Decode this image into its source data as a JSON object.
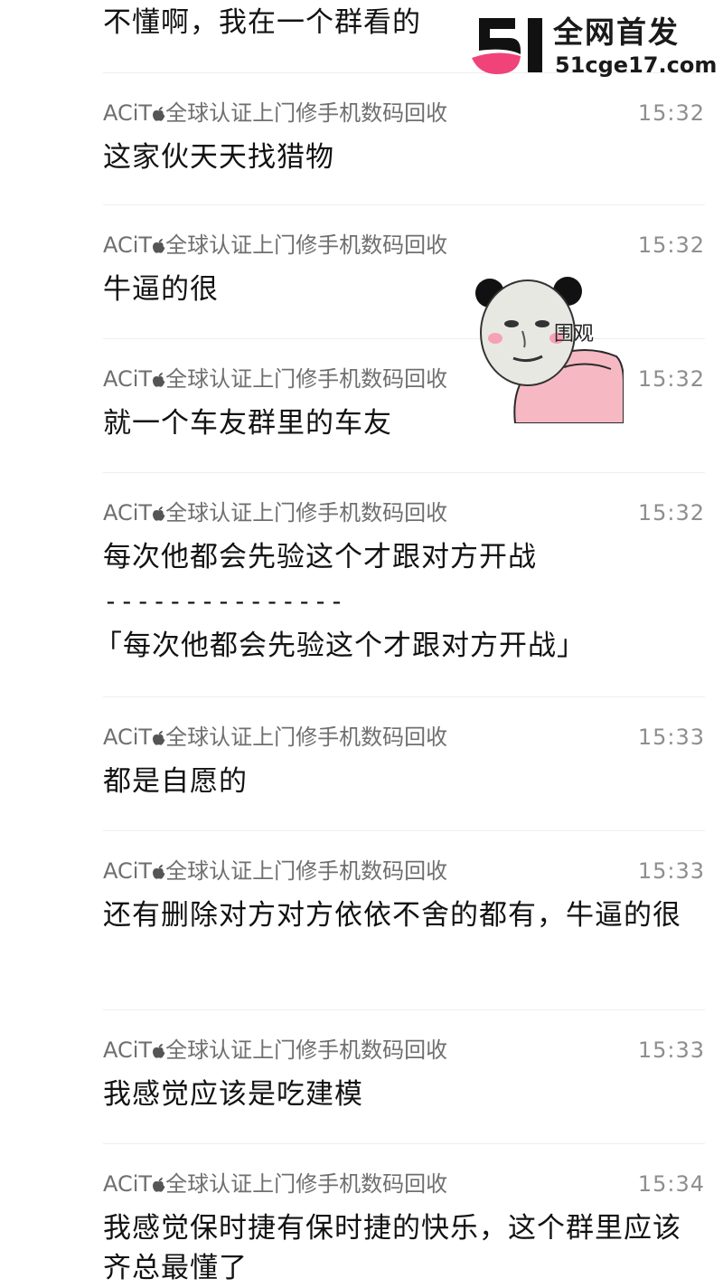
{
  "feed": {
    "top_message": "不懂啊，我在一个群看的",
    "messages": [
      {
        "sender": "ACiT\u0001全球认证上门修手机数码回收",
        "time": "15:32",
        "text": "这家伙天天找猎物"
      },
      {
        "sender": "ACiT\u0001全球认证上门修手机数码回收",
        "time": "15:32",
        "text": "牛逼的很"
      },
      {
        "sender": "ACiT\u0001全球认证上门修手机数码回收",
        "time": "15:32",
        "text": "就一个车友群里的车友"
      },
      {
        "sender": "ACiT\u0001全球认证上门修手机数码回收",
        "time": "15:32",
        "text": "每次他都会先验这个才跟对方开战",
        "dashes": "---------------",
        "quote": "「每次他都会先验这个才跟对方开战」"
      },
      {
        "sender": "ACiT\u0001全球认证上门修手机数码回收",
        "time": "15:33",
        "text": "都是自愿的"
      },
      {
        "sender": "ACiT\u0001全球认证上门修手机数码回收",
        "time": "15:33",
        "text": "还有删除对方对方依依不舍的都有，牛逼的很"
      },
      {
        "sender": "ACiT\u0001全球认证上门修手机数码回收",
        "time": "15:33",
        "text": "我感觉应该是吃建模"
      },
      {
        "sender": "ACiT\u0001全球认证上门修手机数码回收",
        "time": "15:34",
        "text": "我感觉保时捷有保时捷的快乐，这个群里应该齐总最懂了"
      }
    ]
  },
  "watermark": {
    "title": "全网首发",
    "url": "51cge17.com",
    "mark_colors": {
      "dark": "#111111",
      "pink": "#f0437a"
    }
  },
  "sticker": {
    "caption": "围观",
    "icon": "panda-meme-sticker-icon",
    "colors": {
      "skin": "#f6b9c4",
      "face": "#e8e8e2",
      "ear": "#111111"
    }
  },
  "colors": {
    "background": "#ffffff",
    "text": "#121212",
    "sender": "#6f6f6f",
    "time": "#8e8e8e",
    "divider": "#eeeeee"
  }
}
